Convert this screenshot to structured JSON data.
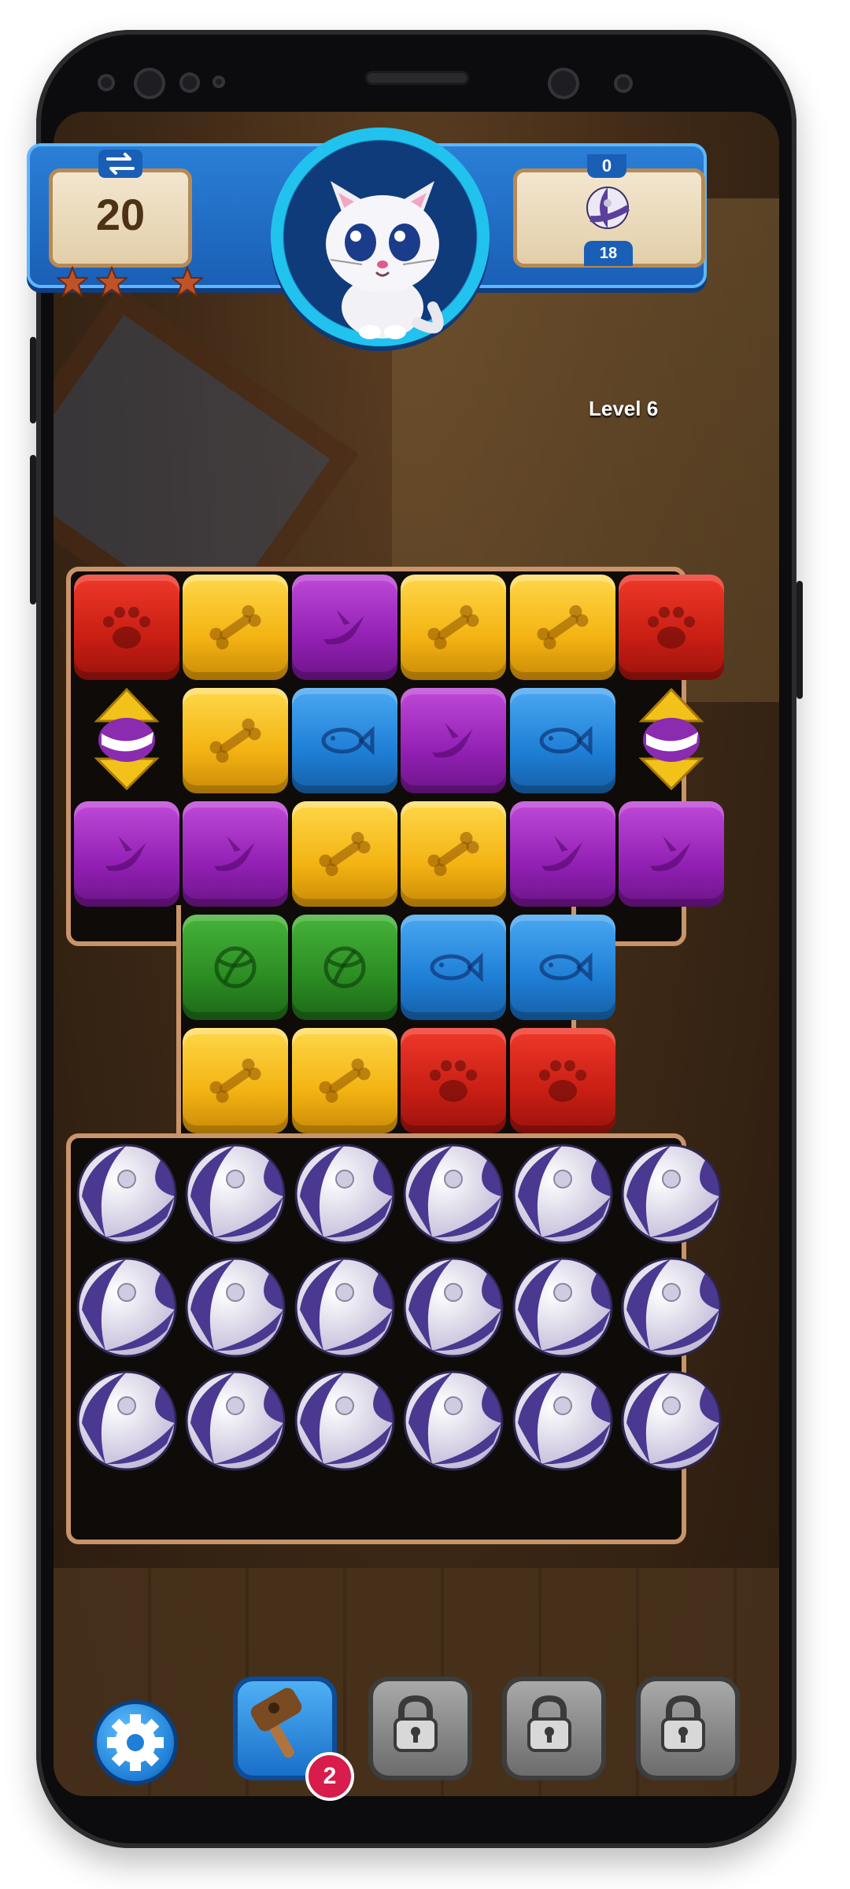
{
  "hud": {
    "moves_left": "20",
    "goal_top_count": "0",
    "goal_bottom_count": "18",
    "level_label": "Level 6",
    "stars_earned": 3,
    "stars_total": 3
  },
  "board": {
    "rows": [
      [
        "red-paw",
        "yellow-bone",
        "purple-bird",
        "yellow-bone",
        "yellow-bone",
        "red-paw"
      ],
      [
        "rocket",
        "yellow-bone",
        "blue-fish",
        "purple-bird",
        "blue-fish",
        "rocket"
      ],
      [
        "purple-bird",
        "purple-bird",
        "yellow-bone",
        "yellow-bone",
        "purple-bird",
        "purple-bird"
      ],
      [
        "empty",
        "green-ball",
        "green-ball",
        "blue-fish",
        "blue-fish",
        "empty"
      ],
      [
        "empty",
        "yellow-bone",
        "yellow-bone",
        "red-paw",
        "red-paw",
        "empty"
      ],
      [
        "beach-ball",
        "beach-ball",
        "beach-ball",
        "beach-ball",
        "beach-ball",
        "beach-ball"
      ],
      [
        "beach-ball",
        "beach-ball",
        "beach-ball",
        "beach-ball",
        "beach-ball",
        "beach-ball"
      ],
      [
        "beach-ball",
        "beach-ball",
        "beach-ball",
        "beach-ball",
        "beach-ball",
        "beach-ball"
      ]
    ]
  },
  "boosters": {
    "settings_icon": "gear-icon",
    "hammer_count": "2",
    "locked_count": 3
  },
  "colors": {
    "hud_blue": "#1a5fb6",
    "board_border": "#c8946a",
    "badge_red": "#d81c4b"
  }
}
